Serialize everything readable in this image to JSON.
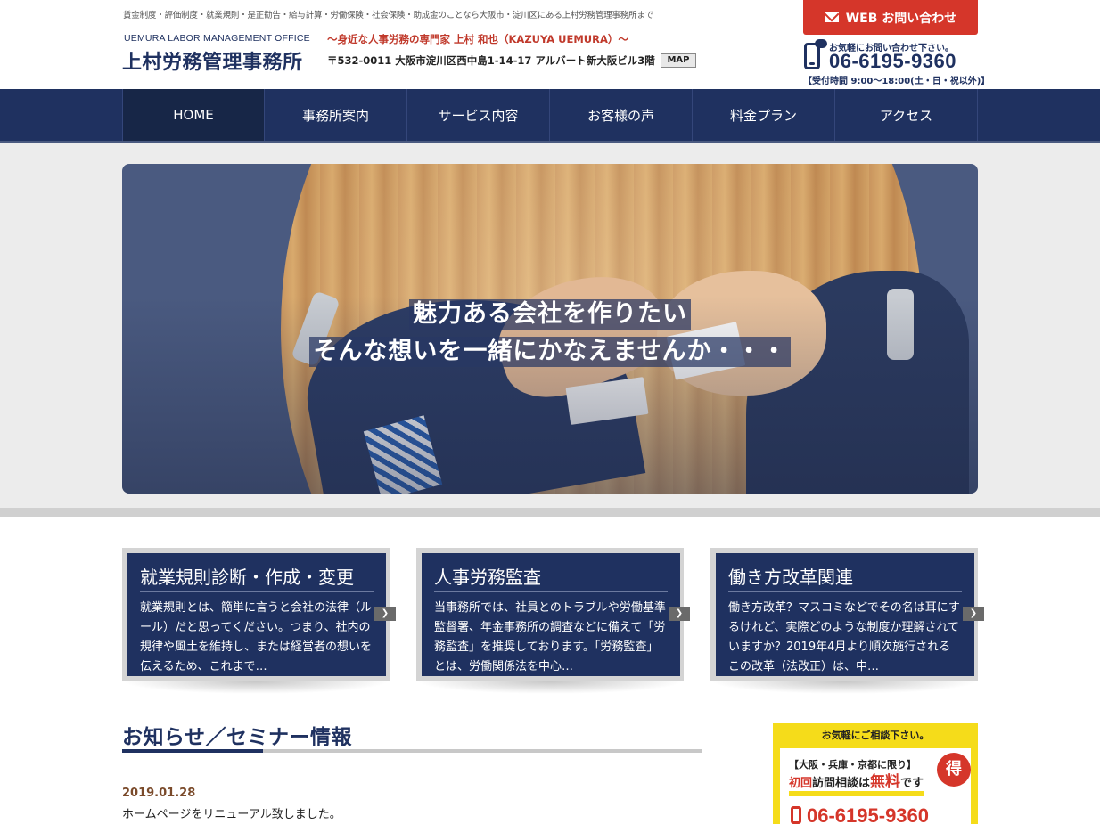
{
  "header": {
    "tagline": "賃金制度・評価制度・就業規則・是正勧告・給与計算・労働保険・社会保険・助成金のことなら大阪市・淀川区にある上村労務管理事務所まで",
    "logo_en": "UEMURA LABOR MANAGEMENT OFFICE",
    "logo_ja": "上村労務管理事務所",
    "catch": "～身近な人事労務の専門家 上村 和也（KAZUYA UEMURA）～",
    "address": "〒532-0011 大阪市淀川区西中島1-14-17 アルバート新大阪ビル3階",
    "map_label": "MAP",
    "web_contact_label": "WEB お問い合わせ",
    "tel_caption": "お気軽にお問い合わせ下さい。",
    "tel_number": "06-6195-9360",
    "tel_hours": "【受付時間 9:00～18:00(土・日・祝以外)】"
  },
  "nav": {
    "items": [
      {
        "label": "HOME"
      },
      {
        "label": "事務所案内"
      },
      {
        "label": "サービス内容"
      },
      {
        "label": "お客様の声"
      },
      {
        "label": "料金プラン"
      },
      {
        "label": "アクセス"
      }
    ]
  },
  "hero": {
    "line1": "魅力ある会社を作りたい",
    "line2": "そんな想いを一緒にかなえませんか・・・"
  },
  "services": [
    {
      "title": "就業規則診断・作成・変更",
      "text": "就業規則とは、簡単に言うと会社の法律（ルール）だと思ってください。つまり、社内の規律や風土を維持し、または経営者の想いを伝えるため、これまで…"
    },
    {
      "title": "人事労務監査",
      "text": "当事務所では、社員とのトラブルや労働基準監督署、年金事務所の調査などに備えて「労務監査」を推奨しております。「労務監査」とは、労働関係法を中心…"
    },
    {
      "title": "働き方改革関連",
      "text": "働き方改革？マスコミなどでその名は耳にするけれど、実際どのような制度か理解されていますか？2019年4月より順次施行されるこの改革（法改正）は、中…"
    }
  ],
  "news": {
    "title": "お知らせ／セミナー情報",
    "items": [
      {
        "date": "2019.01.28",
        "text": "ホームページをリニューアル致しました。"
      }
    ]
  },
  "consult": {
    "head": "お気軽にご相談下さい。",
    "area": "【大阪・兵庫・京都に限り】",
    "free_prefix": "初回",
    "free_middle": "訪問相談は",
    "free_red": "無料",
    "free_suffix": "です",
    "badge": "得",
    "tel": "06-6195-9360"
  },
  "colors": {
    "navy": "#1f3160",
    "red": "#d5362a",
    "yellow": "#f5dc1a"
  }
}
